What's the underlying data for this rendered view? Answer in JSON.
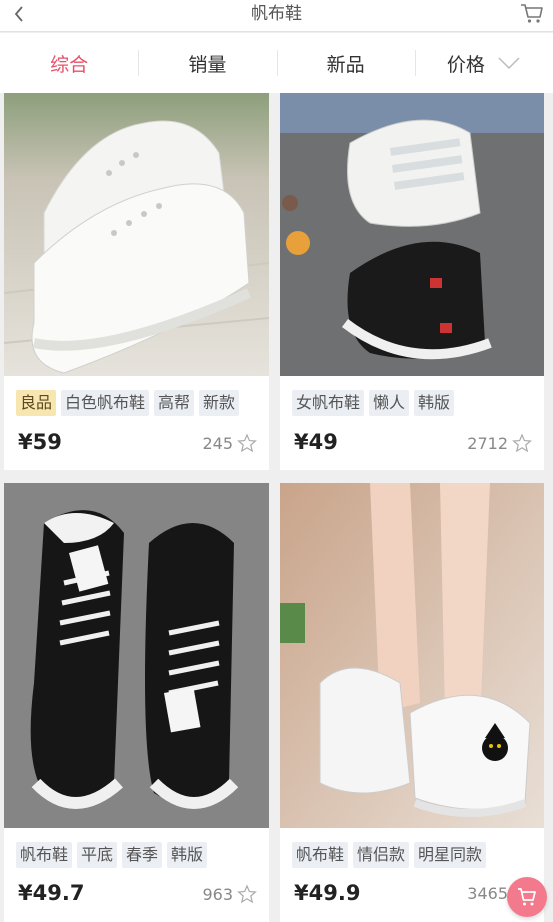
{
  "header": {
    "title": "帆布鞋",
    "back_icon": "chevron-left-icon",
    "cart_icon": "shopping-cart-icon"
  },
  "sort_tabs": [
    {
      "label": "综合",
      "active": true
    },
    {
      "label": "销量",
      "active": false
    },
    {
      "label": "新品",
      "active": false
    },
    {
      "label": "价格",
      "active": false,
      "icon": "chevron-down-icon"
    }
  ],
  "products": [
    {
      "tags": [
        {
          "text": "良品",
          "highlight": true
        },
        {
          "text": "白色帆布鞋"
        },
        {
          "text": "高帮"
        },
        {
          "text": "新款"
        }
      ],
      "price": "¥59",
      "sales": "245",
      "image": "white high-top canvas shoes on wooden floor"
    },
    {
      "tags": [
        {
          "text": "女帆布鞋"
        },
        {
          "text": "懒人"
        },
        {
          "text": "韩版"
        }
      ],
      "price": "¥49",
      "sales": "2712",
      "image": "white and black velcro strap canvas shoes"
    },
    {
      "tags": [
        {
          "text": "帆布鞋"
        },
        {
          "text": "平底"
        },
        {
          "text": "春季"
        },
        {
          "text": "韩版"
        }
      ],
      "price": "¥49.7",
      "sales": "963",
      "image": "black lace-up canvas sneakers on grey concrete"
    },
    {
      "tags": [
        {
          "text": "帆布鞋"
        },
        {
          "text": "情侣款"
        },
        {
          "text": "明星同款"
        }
      ],
      "price": "¥49.9",
      "sales": "3465",
      "image": "white low-top canvas shoes with cat print worn on feet"
    }
  ],
  "colors": {
    "accent": "#e8506a",
    "tag_bg": "#ebeff4",
    "tag_highlight": "#f8e6b0",
    "fab": "#f27a8c"
  }
}
